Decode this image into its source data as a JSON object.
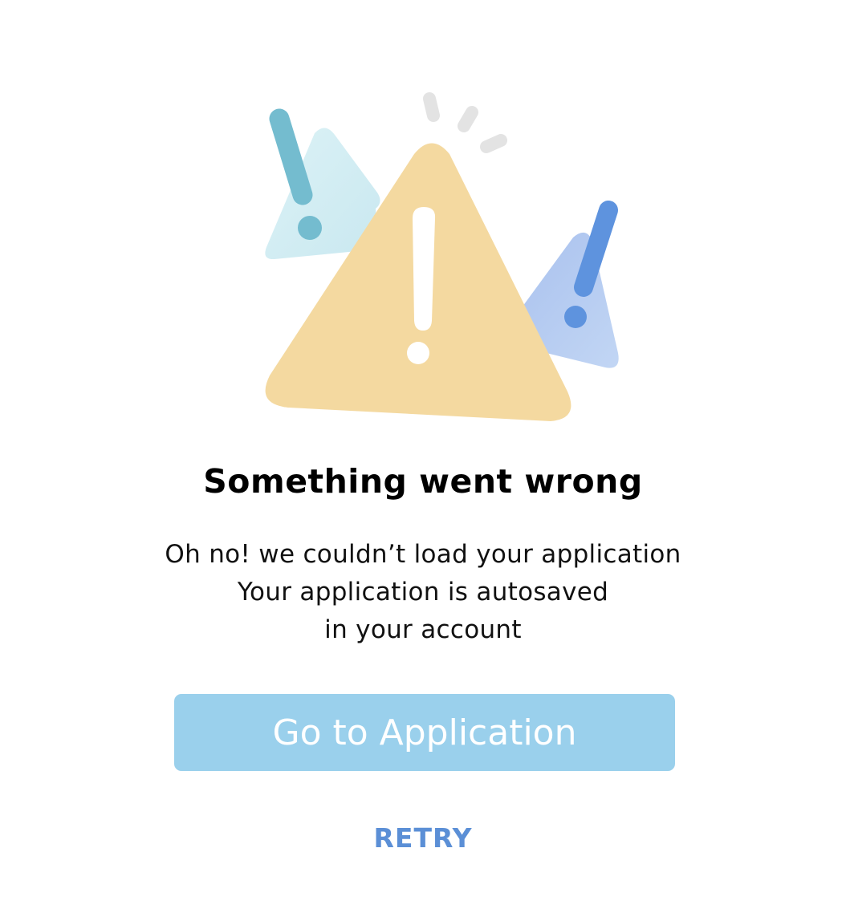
{
  "error": {
    "title": "Something went wrong",
    "message_lines": [
      "Oh no! we couldn’t load your application",
      "Your application is autosaved",
      "in your account"
    ]
  },
  "actions": {
    "primary_label": "Go to Application",
    "secondary_label": "RETRY"
  },
  "colors": {
    "warning_yellow": "#f4d9a0",
    "left_triangle": "#d3eef4",
    "left_mark": "#74bccf",
    "right_triangle": "#b3c9f0",
    "right_mark": "#5e93de",
    "spark": "#e3e3e3",
    "primary_button": "#9ad0ec",
    "retry_link": "#5b8fd6"
  },
  "illustration": {
    "icons": [
      "warning-triangle-icon",
      "exclamation-icon",
      "alert-spark-icon"
    ]
  }
}
